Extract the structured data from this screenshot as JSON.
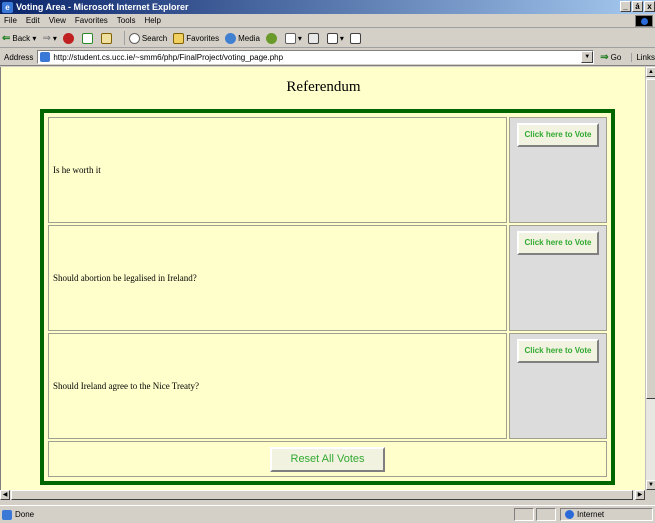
{
  "window": {
    "title": "Voting Area - Microsoft Internet Explorer",
    "controls": [
      "_",
      "á",
      "x"
    ]
  },
  "menubar": {
    "items": [
      "File",
      "Edit",
      "View",
      "Favorites",
      "Tools",
      "Help"
    ]
  },
  "toolbar": {
    "back_label": "Back",
    "search_label": "Search",
    "favorites_label": "Favorites",
    "media_label": "Media"
  },
  "address": {
    "label": "Address",
    "url": "http://student.cs.ucc.ie/~smm6/php/FinalProject/voting_page.php",
    "go_label": "Go",
    "links_label": "Links"
  },
  "page": {
    "heading": "Referendum",
    "questions": [
      {
        "text": "Is he worth it",
        "button_label": "Click here to Vote"
      },
      {
        "text": "Should abortion be legalised in Ireland?",
        "button_label": "Click here to Vote"
      },
      {
        "text": "Should Ireland agree to the Nice Treaty?",
        "button_label": "Click here to Vote"
      }
    ],
    "reset_label": "Reset All Votes"
  },
  "status": {
    "text": "Done",
    "zone": "Internet"
  },
  "colors": {
    "page_background": "#ffffcc",
    "table_border": "#006600",
    "button_text": "#33aa33",
    "title_bar": "#0a246a"
  }
}
